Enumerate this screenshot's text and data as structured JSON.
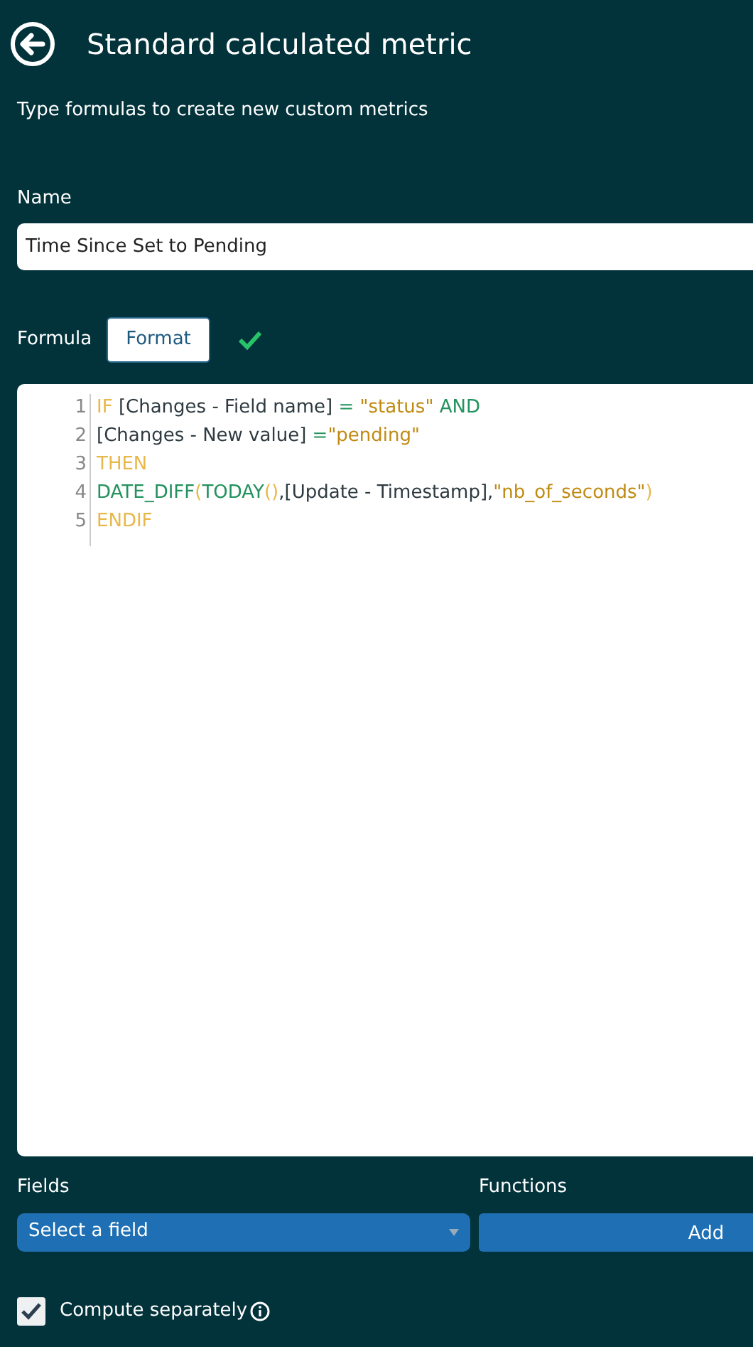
{
  "header": {
    "title": "Standard calculated metric"
  },
  "subtitle": "Type formulas to create new custom metrics",
  "name_field": {
    "label": "Name",
    "value": "Time Since Set to Pending"
  },
  "formula": {
    "label": "Formula",
    "format_button": "Format",
    "valid": true
  },
  "editor": {
    "lines": [
      {
        "number": "1",
        "tokens": [
          {
            "kind": "keyword",
            "text": "IF"
          },
          {
            "kind": "plain",
            "text": " [Changes - Field name] "
          },
          {
            "kind": "operator",
            "text": "="
          },
          {
            "kind": "string",
            "text": " \"status\""
          },
          {
            "kind": "operator",
            "text": " AND"
          }
        ]
      },
      {
        "number": "2",
        "tokens": [
          {
            "kind": "plain",
            "text": "[Changes - New value] "
          },
          {
            "kind": "operator",
            "text": "="
          },
          {
            "kind": "string",
            "text": "\"pending\""
          }
        ]
      },
      {
        "number": "3",
        "tokens": [
          {
            "kind": "keyword",
            "text": "THEN"
          }
        ]
      },
      {
        "number": "4",
        "tokens": [
          {
            "kind": "function",
            "text": "DATE_DIFF"
          },
          {
            "kind": "keyword",
            "text": "("
          },
          {
            "kind": "function",
            "text": "TODAY"
          },
          {
            "kind": "keyword",
            "text": "()"
          },
          {
            "kind": "plain",
            "text": ",[Update - Timestamp],"
          },
          {
            "kind": "string",
            "text": "\"nb_of_seconds\""
          },
          {
            "kind": "keyword",
            "text": ")"
          }
        ]
      },
      {
        "number": "5",
        "tokens": [
          {
            "kind": "keyword",
            "text": "ENDIF"
          }
        ]
      }
    ]
  },
  "fields": {
    "label": "Fields",
    "placeholder": "Select a field"
  },
  "functions": {
    "label": "Functions",
    "button": "Add"
  },
  "compute_separately": {
    "label": "Compute separately",
    "checked": true
  }
}
